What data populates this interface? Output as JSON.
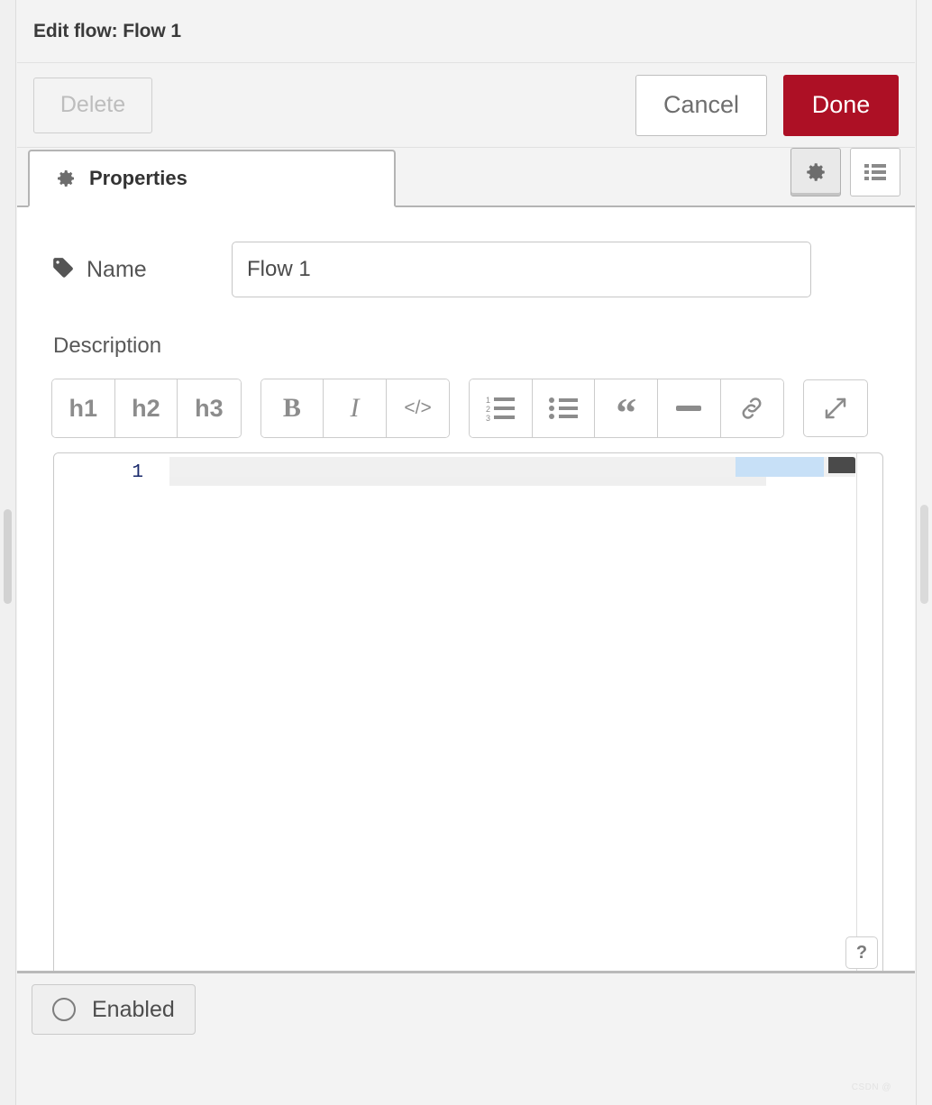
{
  "dialog": {
    "title": "Edit flow: Flow 1"
  },
  "actions": {
    "delete_label": "Delete",
    "cancel_label": "Cancel",
    "done_label": "Done",
    "done_color": "#ad1025"
  },
  "tabs": [
    {
      "label": "Properties",
      "icon": "gear-icon",
      "active": true
    }
  ],
  "tab_tools": [
    {
      "name": "properties-view-toggle",
      "icon": "gear-icon",
      "active": true
    },
    {
      "name": "list-view-toggle",
      "icon": "list-icon",
      "active": false
    }
  ],
  "form": {
    "name": {
      "label": "Name",
      "icon": "tag-icon",
      "value": "Flow 1",
      "placeholder": "Name"
    },
    "description": {
      "label": "Description"
    }
  },
  "markdown_toolbar": {
    "groups": [
      {
        "name": "heading-group",
        "buttons": [
          {
            "name": "heading-1-button",
            "label": "h1",
            "kind": "text"
          },
          {
            "name": "heading-2-button",
            "label": "h2",
            "kind": "text"
          },
          {
            "name": "heading-3-button",
            "label": "h3",
            "kind": "text"
          }
        ]
      },
      {
        "name": "format-group",
        "buttons": [
          {
            "name": "bold-button",
            "label": "B",
            "kind": "serif-bold"
          },
          {
            "name": "italic-button",
            "label": "I",
            "kind": "serif-italic"
          },
          {
            "name": "code-button",
            "label": "</>",
            "kind": "code"
          }
        ]
      },
      {
        "name": "block-group",
        "buttons": [
          {
            "name": "ordered-list-button",
            "label": "",
            "kind": "icon-ordered-list"
          },
          {
            "name": "unordered-list-button",
            "label": "",
            "kind": "icon-unordered-list"
          },
          {
            "name": "blockquote-button",
            "label": "“",
            "kind": "quote"
          },
          {
            "name": "horizontal-rule-button",
            "label": "",
            "kind": "icon-hrule"
          },
          {
            "name": "link-button",
            "label": "",
            "kind": "icon-link"
          }
        ]
      }
    ],
    "expand": {
      "name": "expand-editor-button",
      "icon": "expand-arrows-icon"
    }
  },
  "editor": {
    "line_numbers": [
      "1"
    ],
    "content": "",
    "help_label": "?"
  },
  "footer": {
    "enabled_label": "Enabled",
    "enabled_state": false
  },
  "watermark": "CSDN @"
}
